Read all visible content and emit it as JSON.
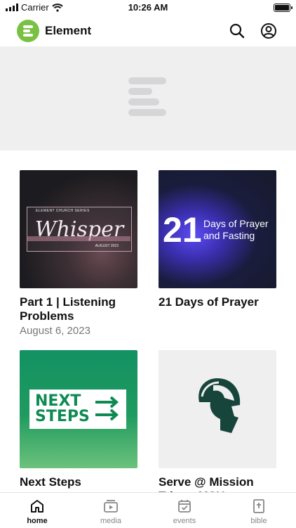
{
  "status_bar": {
    "carrier": "Carrier",
    "time": "10:26 AM"
  },
  "header": {
    "app_name": "Element"
  },
  "cards": [
    {
      "title": "Part 1 | Listening Problems",
      "date": "August 6, 2023",
      "thumb": {
        "series_label": "ELEMENT CHURCH SERIES",
        "word": "Whisper",
        "thumb_date": "AUGUST 2023"
      }
    },
    {
      "title": "21 Days of Prayer",
      "thumb": {
        "number": "21",
        "line1": "Days of Prayer",
        "line2": "and Fasting"
      }
    },
    {
      "title": "Next Steps",
      "thumb": {
        "line1": "NEXT",
        "line2": "STEPS"
      }
    },
    {
      "title": "Serve @ Mission Trip to MSU"
    }
  ],
  "tabs": [
    {
      "label": "home",
      "icon": "home-icon",
      "active": true
    },
    {
      "label": "media",
      "icon": "media-icon",
      "active": false
    },
    {
      "label": "events",
      "icon": "events-icon",
      "active": false
    },
    {
      "label": "bible",
      "icon": "bible-icon",
      "active": false
    }
  ],
  "colors": {
    "brand_green": "#7ac143",
    "next_steps_green": "#0f8a53",
    "msu_green": "#18453b"
  }
}
